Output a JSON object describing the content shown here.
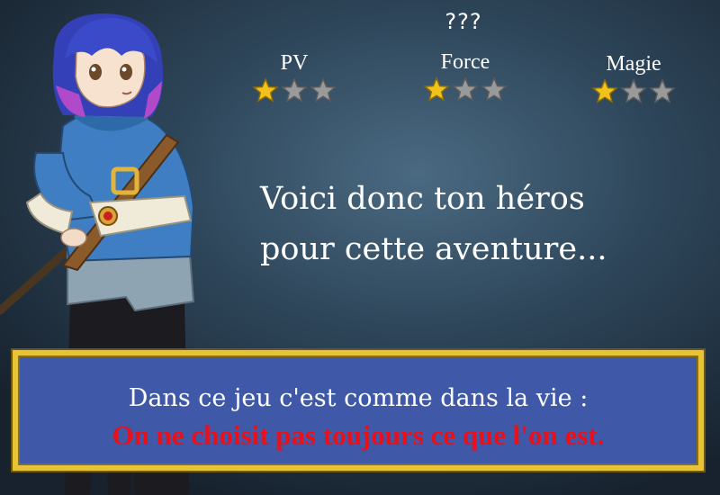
{
  "character": {
    "name": "???"
  },
  "stats": [
    {
      "label": "PV",
      "filled": 1,
      "max": 3
    },
    {
      "label": "Force",
      "filled": 1,
      "max": 3
    },
    {
      "label": "Magie",
      "filled": 1,
      "max": 3
    }
  ],
  "intro": {
    "line1": "Voici donc ton héros",
    "line2": "pour cette aventure..."
  },
  "message": {
    "line1": "Dans ce jeu c'est comme dans la vie :",
    "line2": "On ne choisit pas toujours ce que l'on est."
  },
  "colors": {
    "star_filled": "#f2c21c",
    "star_empty": "#9a9a9a",
    "box_fill": "#3f59a8",
    "box_border": "#e7c436",
    "warning_text": "#e8101a"
  },
  "icons": {
    "star": "star-icon"
  }
}
